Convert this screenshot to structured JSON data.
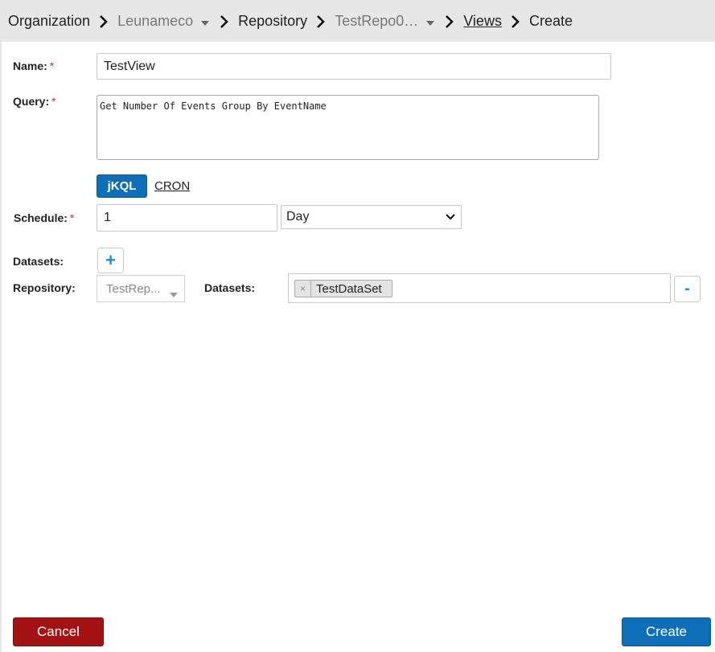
{
  "breadcrumb": {
    "organization": "Organization",
    "org_name": "Leunameco",
    "repository": "Repository",
    "repo_name": "TestRepo0…",
    "views": "Views",
    "current": "Create"
  },
  "form": {
    "name_label": "Name:",
    "name_value": "TestView",
    "query_label": "Query:",
    "query_value": "Get Number Of Events Group By EventName",
    "required_mark": "*",
    "tab_jkql": "jKQL",
    "tab_cron": "CRON",
    "schedule_label": "Schedule:",
    "schedule_value": "1",
    "schedule_unit": "Day",
    "datasets_label": "Datasets:",
    "add_dataset": "+",
    "repository_label": "Repository:",
    "repository_value": "TestRep...",
    "datasets_field_label": "Datasets:",
    "dataset_tag": "TestDataSet",
    "tag_remove": "×",
    "remove_dataset": "-"
  },
  "footer": {
    "cancel": "Cancel",
    "create": "Create"
  },
  "colors": {
    "primary": "#0d6fb8",
    "danger": "#a41313",
    "breadcrumb_bg": "#e7e7e7",
    "required": "#c0392b"
  }
}
